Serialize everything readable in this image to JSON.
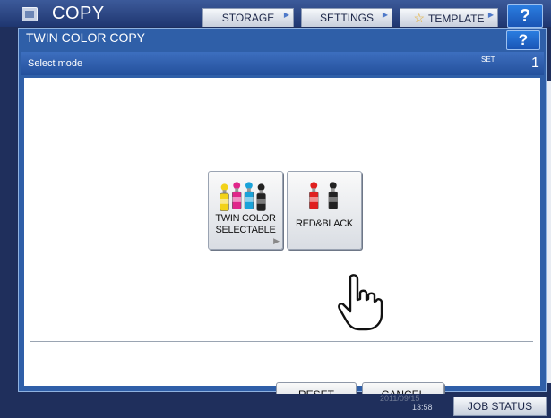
{
  "app": {
    "title": "COPY"
  },
  "tabs": [
    {
      "label": "STORAGE"
    },
    {
      "label": "SETTINGS"
    },
    {
      "label": "TEMPLATE"
    }
  ],
  "help": {
    "label": "?"
  },
  "dialog": {
    "title": "TWIN COLOR COPY",
    "help_label": "?",
    "mode_label": "Select mode",
    "set_label": "SET",
    "set_count": "1",
    "options": [
      {
        "line1": "TWIN COLOR",
        "line2": "SELECTABLE",
        "icon": "four-toner-bottles-icon"
      },
      {
        "line1": "RED&BLACK",
        "icon": "red-black-toner-bottles-icon"
      }
    ],
    "reset_label": "RESET",
    "cancel_label": "CANCEL"
  },
  "footer": {
    "date": "2011/09/15",
    "time": "13:58",
    "job_status_label": "JOB STATUS"
  },
  "colors": {
    "accent_blue": "#2f5fa8",
    "yellow": "#f2d21a",
    "magenta": "#e0268a",
    "cyan": "#1aa3d9",
    "black": "#222222",
    "red": "#e02020"
  }
}
